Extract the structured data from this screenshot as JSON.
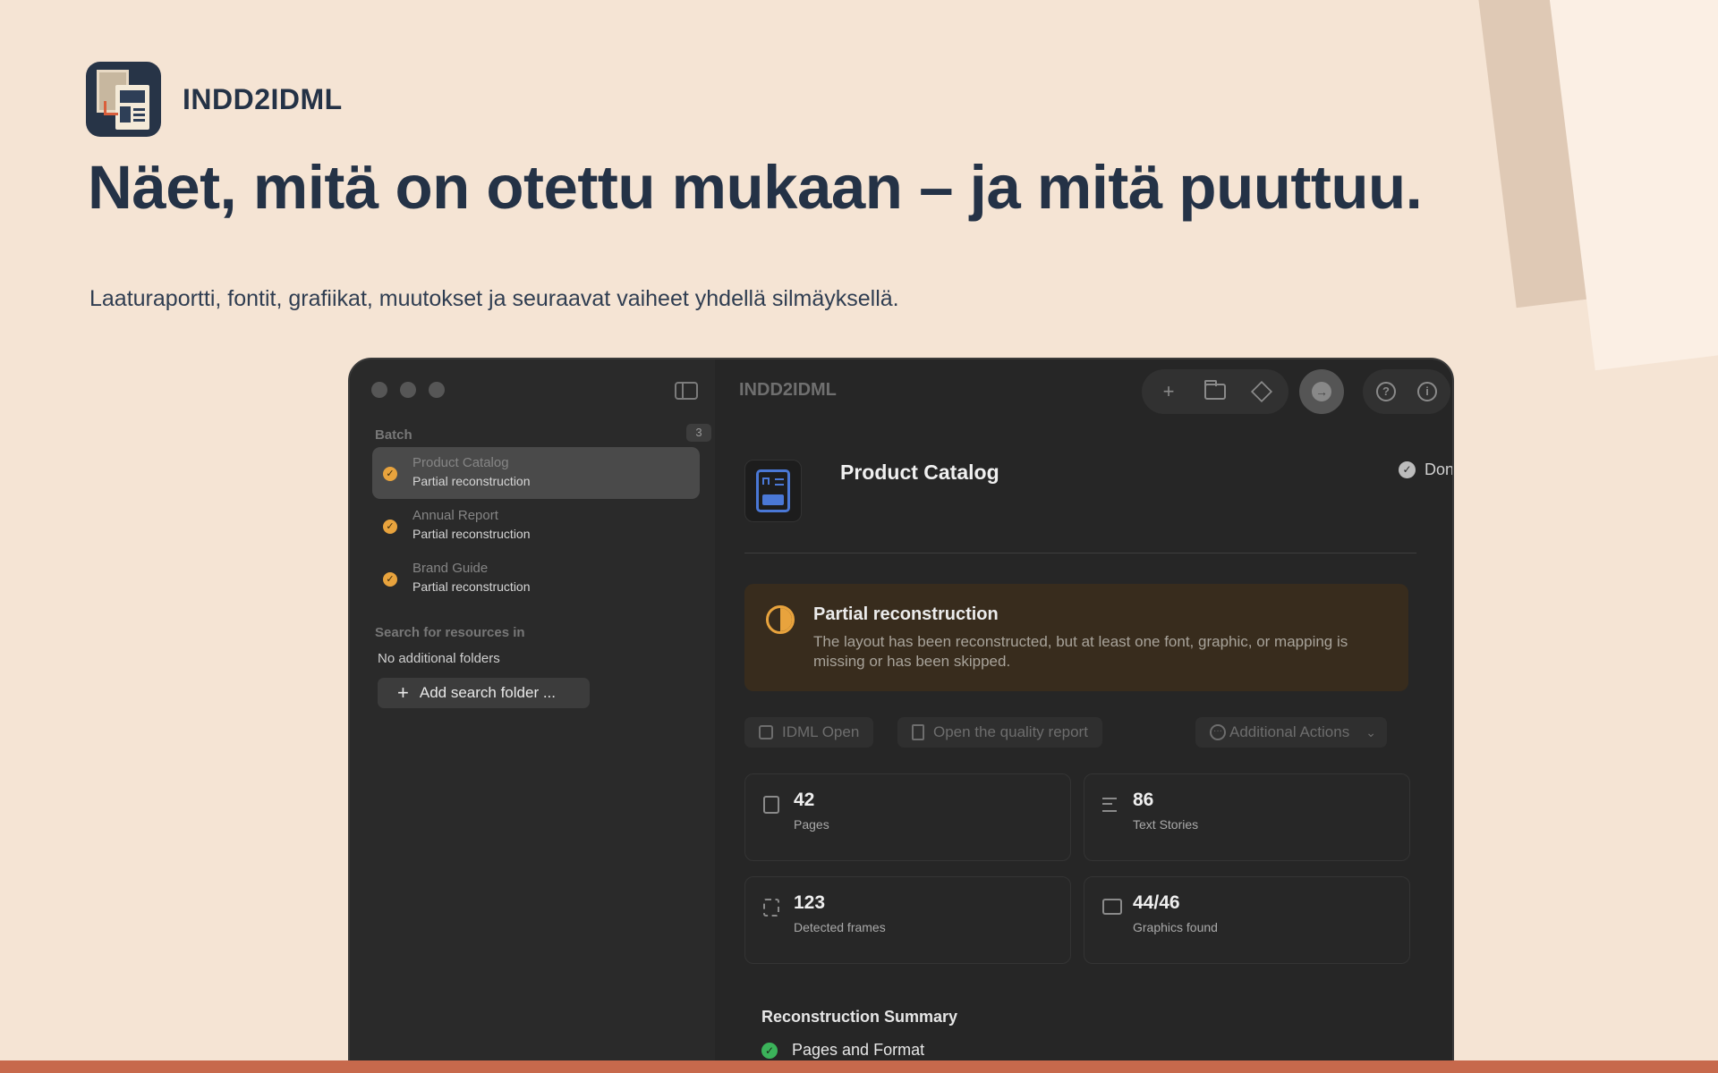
{
  "brand": {
    "name": "INDD2IDML"
  },
  "headline": "Näet, mitä on otettu mukaan – ja mitä puuttuu.",
  "subline": "Laaturaportti, fontit, grafiikat, muutokset ja seuraavat vaiheet yhdellä silmäyksellä.",
  "colors": {
    "background": "#f5e4d4",
    "accent_bar": "#c7694c",
    "warning": "#e8a33d",
    "success": "#3bb35a"
  },
  "sidebar": {
    "batch_label": "Batch",
    "batch_count": "3",
    "items": [
      {
        "title": "Product Catalog",
        "status": "Partial reconstruction"
      },
      {
        "title": "Annual Report",
        "status": "Partial reconstruction"
      },
      {
        "title": "Brand Guide",
        "status": "Partial reconstruction"
      }
    ],
    "search_label": "Search for resources in",
    "no_folders": "No additional folders",
    "add_folder": "Add search folder ..."
  },
  "window": {
    "title": "INDD2IDML",
    "toolbar_icons": [
      "plus-icon",
      "folder-icon",
      "package-icon",
      "convert-icon",
      "help-icon",
      "info-icon"
    ]
  },
  "document": {
    "title": "Product Catalog",
    "status": "Done",
    "banner": {
      "title": "Partial reconstruction",
      "body": "The layout has been reconstructed, but at least one font, graphic, or mapping is missing or has been skipped."
    },
    "actions": {
      "idml_open": "IDML Open",
      "quality_report": "Open the quality report",
      "additional": "Additional Actions"
    },
    "stats": [
      {
        "value": "42",
        "label": "Pages"
      },
      {
        "value": "86",
        "label": "Text Stories"
      },
      {
        "value": "123",
        "label": "Detected frames"
      },
      {
        "value": "44/46",
        "label": "Graphics found"
      }
    ],
    "summary": {
      "title": "Reconstruction Summary",
      "items": [
        {
          "label": "Pages and Format"
        }
      ]
    }
  }
}
